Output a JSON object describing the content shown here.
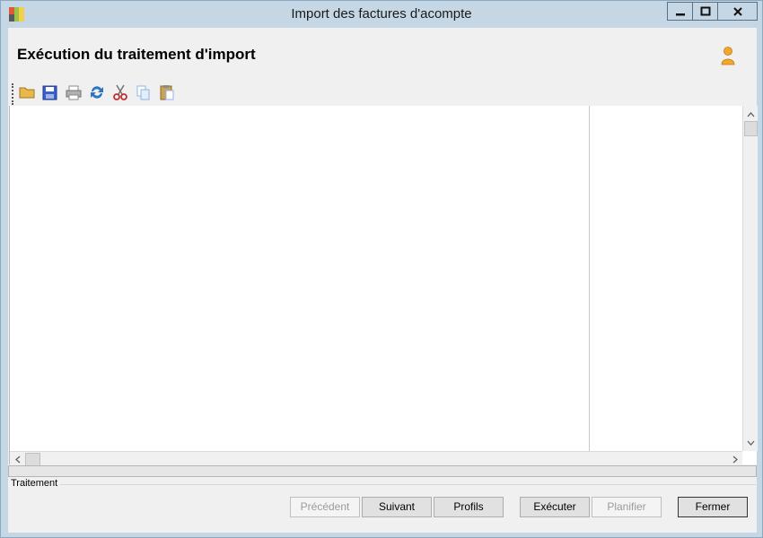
{
  "window": {
    "title": "Import des factures d'acompte",
    "controls": {
      "minimize": "▬",
      "maximize": "◻",
      "close": "✕"
    }
  },
  "header": {
    "title": "Exécution du traitement d'import"
  },
  "toolbar": {
    "items": [
      {
        "icon": "open-folder-icon",
        "color": "#e8b84a"
      },
      {
        "icon": "save-icon",
        "color": "#3a5fcd"
      },
      {
        "icon": "print-icon",
        "color": "#8a8a8a"
      },
      {
        "icon": "refresh-icon",
        "color": "#2f74c0"
      },
      {
        "icon": "cut-icon",
        "color": "#c03030"
      },
      {
        "icon": "copy-icon",
        "color": "#8fb4e3"
      },
      {
        "icon": "paste-icon",
        "color": "#c9a35b"
      }
    ]
  },
  "progress": {
    "value": 0
  },
  "group": {
    "label": "Traitement"
  },
  "buttons": {
    "previous": "Précédent",
    "next": "Suivant",
    "profiles": "Profils",
    "execute": "Exécuter",
    "schedule": "Planifier",
    "close": "Fermer"
  },
  "colors": {
    "titlebar": "#c5d7e4",
    "client": "#f0f0f0",
    "user_icon": "#f0a830"
  }
}
